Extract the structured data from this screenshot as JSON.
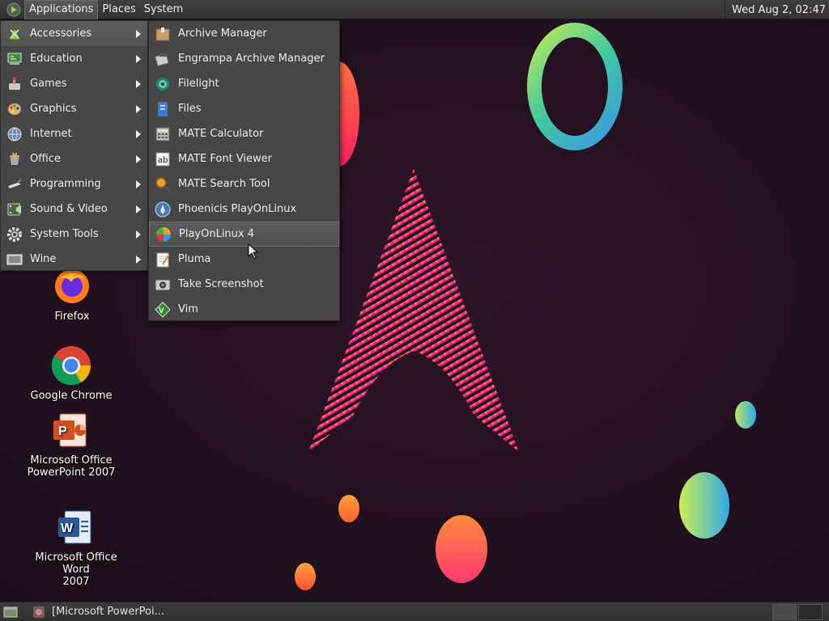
{
  "top_panel": {
    "menus": [
      "Applications",
      "Places",
      "System"
    ],
    "clock": "Wed Aug  2, 02:47"
  },
  "app_menu": {
    "items": [
      {
        "label": "Accessories",
        "icon": "accessories-icon"
      },
      {
        "label": "Education",
        "icon": "education-icon"
      },
      {
        "label": "Games",
        "icon": "games-icon"
      },
      {
        "label": "Graphics",
        "icon": "graphics-icon"
      },
      {
        "label": "Internet",
        "icon": "internet-icon"
      },
      {
        "label": "Office",
        "icon": "office-icon"
      },
      {
        "label": "Programming",
        "icon": "programming-icon"
      },
      {
        "label": "Sound & Video",
        "icon": "sound-video-icon"
      },
      {
        "label": "System Tools",
        "icon": "system-tools-icon"
      },
      {
        "label": "Wine",
        "icon": "wine-icon"
      }
    ],
    "active_index": 0
  },
  "sub_menu": {
    "items": [
      {
        "label": "Archive Manager",
        "icon": "archive-manager-icon"
      },
      {
        "label": "Engrampa Archive Manager",
        "icon": "engrampa-icon"
      },
      {
        "label": "Filelight",
        "icon": "filelight-icon"
      },
      {
        "label": "Files",
        "icon": "files-icon"
      },
      {
        "label": "MATE Calculator",
        "icon": "calculator-icon"
      },
      {
        "label": "MATE Font Viewer",
        "icon": "font-viewer-icon"
      },
      {
        "label": "MATE Search Tool",
        "icon": "search-tool-icon"
      },
      {
        "label": "Phoenicis PlayOnLinux",
        "icon": "phoenicis-icon"
      },
      {
        "label": "PlayOnLinux 4",
        "icon": "playonlinux-icon"
      },
      {
        "label": "Pluma",
        "icon": "pluma-icon"
      },
      {
        "label": "Take Screenshot",
        "icon": "screenshot-icon"
      },
      {
        "label": "Vim",
        "icon": "vim-icon"
      }
    ],
    "hover_index": 8
  },
  "desktop_icons": [
    {
      "label": "Firefox",
      "icon": "firefox-icon"
    },
    {
      "label": "Google Chrome",
      "icon": "chrome-icon"
    },
    {
      "label": "Microsoft Office PowerPoint 2007",
      "line1": "Microsoft Office",
      "line2": "PowerPoint 2007",
      "icon": "powerpoint-icon"
    },
    {
      "label": "Microsoft Office Word 2007",
      "line1": "Microsoft Office Word",
      "line2": "2007",
      "icon": "word-icon"
    }
  ],
  "taskbar": {
    "window_title": "[Microsoft PowerPoi..."
  },
  "colors": {
    "panel": "#3a3a3a",
    "menu_bg": "#464646",
    "desktop_bg": "#24101f",
    "accent_pink": "#e8206f",
    "accent_orange": "#ff8a3d"
  }
}
